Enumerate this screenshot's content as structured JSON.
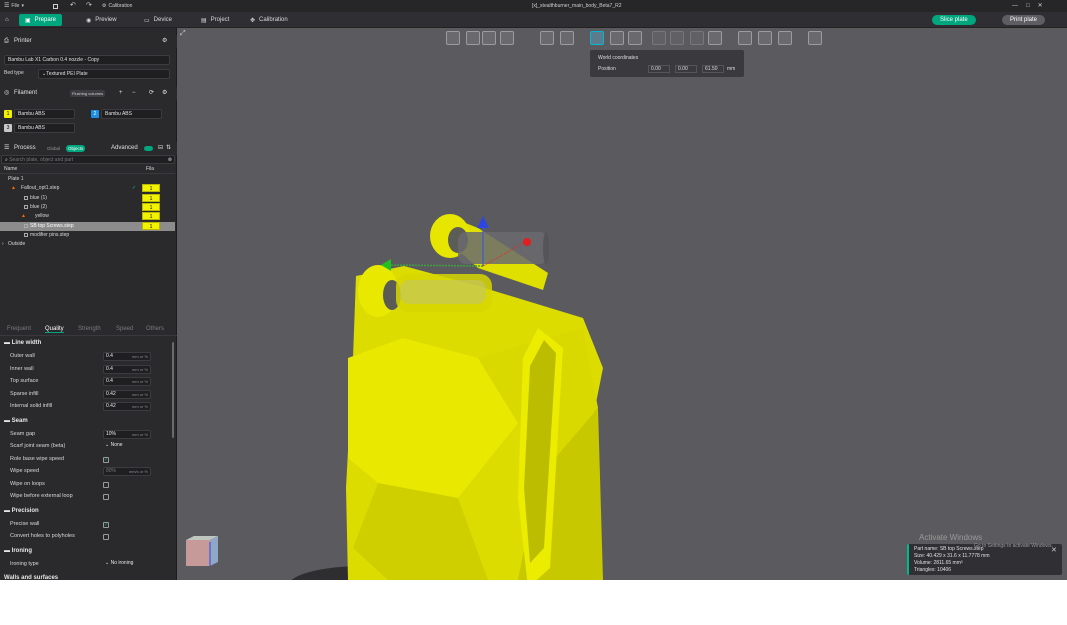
{
  "titlebar": {
    "file_label": "File",
    "calibration_label": "Calibration",
    "project_title": "[x]_stealthburner_main_body_Beta7_R2"
  },
  "tabs": [
    {
      "label": "Prepare",
      "icon": "box-icon"
    },
    {
      "label": "Preview",
      "icon": "eye-icon"
    },
    {
      "label": "Device",
      "icon": "device-icon"
    },
    {
      "label": "Project",
      "icon": "project-icon"
    },
    {
      "label": "Calibration",
      "icon": "calibration-icon"
    }
  ],
  "actions": {
    "slice": "Slice plate",
    "print": "Print plate"
  },
  "printer": {
    "section_title": "Printer",
    "name": "Bambu Lab X1 Carbon 0.4 nozzle - Copy",
    "bed_type_label": "Bed type",
    "bed_type": "Textured PEI Plate"
  },
  "filament": {
    "section_title": "Filament",
    "flushing_label": "Flushing volumes",
    "items": [
      {
        "num": "1",
        "name": "Bambu ABS",
        "color": "#f2f200"
      },
      {
        "num": "2",
        "name": "Bambu ABS",
        "color": "#1e8fe6"
      },
      {
        "num": "3",
        "name": "Bambu ABS",
        "color": "#c8c8c8"
      }
    ]
  },
  "process": {
    "section_title": "Process",
    "global_label": "Global",
    "objects_label": "Objects",
    "advanced_label": "Advanced",
    "search_placeholder": "Search plate, object and part",
    "col_name": "Name",
    "col_fila": "Fila",
    "tree": [
      {
        "name": "Plate 1",
        "indent": 0,
        "fila": ""
      },
      {
        "name": "Fallout_opt1.step",
        "indent": 1,
        "fila": "1",
        "warn": true,
        "check": true
      },
      {
        "name": "blue (1)",
        "indent": 2,
        "fila": "1"
      },
      {
        "name": "blue (2)",
        "indent": 2,
        "fila": "1"
      },
      {
        "name": "yellow",
        "indent": 3,
        "fila": "1",
        "warn": true
      },
      {
        "name": "SB top Screws.step",
        "indent": 2,
        "fila": "1",
        "selected": true
      },
      {
        "name": "modifier pins.step",
        "indent": 2,
        "fila": ""
      },
      {
        "name": "Outside",
        "indent": 0,
        "fila": ""
      }
    ]
  },
  "setting_tabs": [
    "Frequent",
    "Quality",
    "Strength",
    "Speed",
    "Others"
  ],
  "settings": {
    "line_width": {
      "title": "Line width",
      "rows": [
        {
          "label": "Outer wall",
          "value": "0.4",
          "unit": "mm or %"
        },
        {
          "label": "Inner wall",
          "value": "0.4",
          "unit": "mm or %"
        },
        {
          "label": "Top surface",
          "value": "0.4",
          "unit": "mm or %"
        },
        {
          "label": "Sparse infill",
          "value": "0.42",
          "unit": "mm or %"
        },
        {
          "label": "Internal solid infill",
          "value": "0.42",
          "unit": "mm or %"
        }
      ]
    },
    "seam": {
      "title": "Seam",
      "rows": [
        {
          "label": "Seam gap",
          "value": "10%",
          "unit": "mm or %"
        },
        {
          "label": "Scarf joint seam (beta)",
          "value": "None",
          "unit": ""
        },
        {
          "label": "Role base wipe speed",
          "check": true
        },
        {
          "label": "Wipe speed",
          "value": "80%",
          "unit": "mm/s or %"
        },
        {
          "label": "Wipe on loops",
          "check": false
        },
        {
          "label": "Wipe before external loop",
          "check": false
        }
      ]
    },
    "precision": {
      "title": "Precision",
      "rows": [
        {
          "label": "Precise wall",
          "check": true
        },
        {
          "label": "Convert holes to polyholes",
          "check": false
        }
      ]
    },
    "ironing": {
      "title": "Ironing",
      "rows": [
        {
          "label": "Ironing type",
          "value": "No ironing"
        }
      ]
    },
    "walls_title": "Walls and surfaces"
  },
  "coords": {
    "title": "World coordinates",
    "position_label": "Position",
    "x": "0.00",
    "y": "0.00",
    "z": "61.50",
    "unit": "mm"
  },
  "part_info": {
    "name": "Part name: SB top Screws.step",
    "size": "Size: 40.429 x 31.6 x 11.7778 mm",
    "volume": "Volume: 2811.65 mm³",
    "triangles": "Triangles: 10406"
  },
  "watermark": {
    "line1": "Activate Windows",
    "line2": "Go to Settings to activate Windows."
  },
  "colors": {
    "accent": "#00a67e",
    "model_yellow": "#f2f200",
    "viewport_bg": "#5b5b5f",
    "panel_bg": "#2a2a2d"
  }
}
